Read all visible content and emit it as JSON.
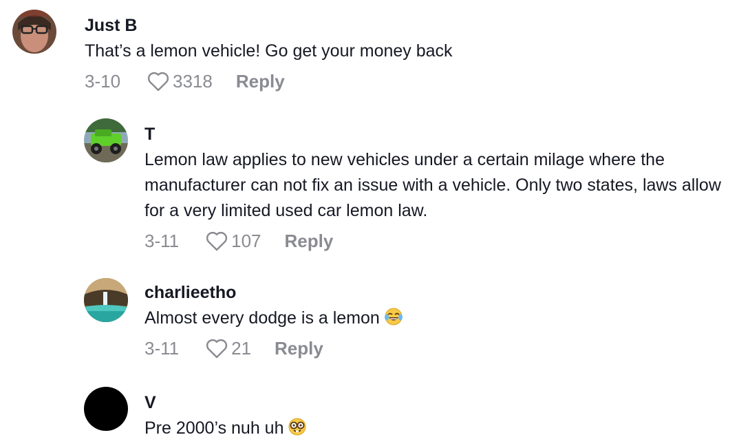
{
  "comments": [
    {
      "username": "Just B",
      "text": "That’s a lemon vehicle! Go get your money back",
      "date": "3-10",
      "likes": "3318",
      "reply_label": "Reply",
      "avatar": "profile-photo-person-glasses"
    },
    {
      "username": "T",
      "text": "Lemon law applies to new vehicles under a certain milage where the manufacturer can not fix an issue with a vehicle. Only two states, laws allow for a very limited used car lemon law.",
      "date": "3-11",
      "likes": "107",
      "reply_label": "Reply",
      "avatar": "profile-photo-green-jeep"
    },
    {
      "username": "charlieetho",
      "text": "Almost every dodge is a lemon",
      "emoji": "tears-of-joy-emoji",
      "date": "3-11",
      "likes": "21",
      "reply_label": "Reply",
      "avatar": "profile-photo-waterfall"
    },
    {
      "username": "V",
      "text": "Pre 2000’s nuh uh",
      "emoji": "nerd-face-emoji",
      "avatar": "profile-photo-black"
    }
  ],
  "colors": {
    "text": "#161823",
    "meta": "#8a8b91"
  }
}
